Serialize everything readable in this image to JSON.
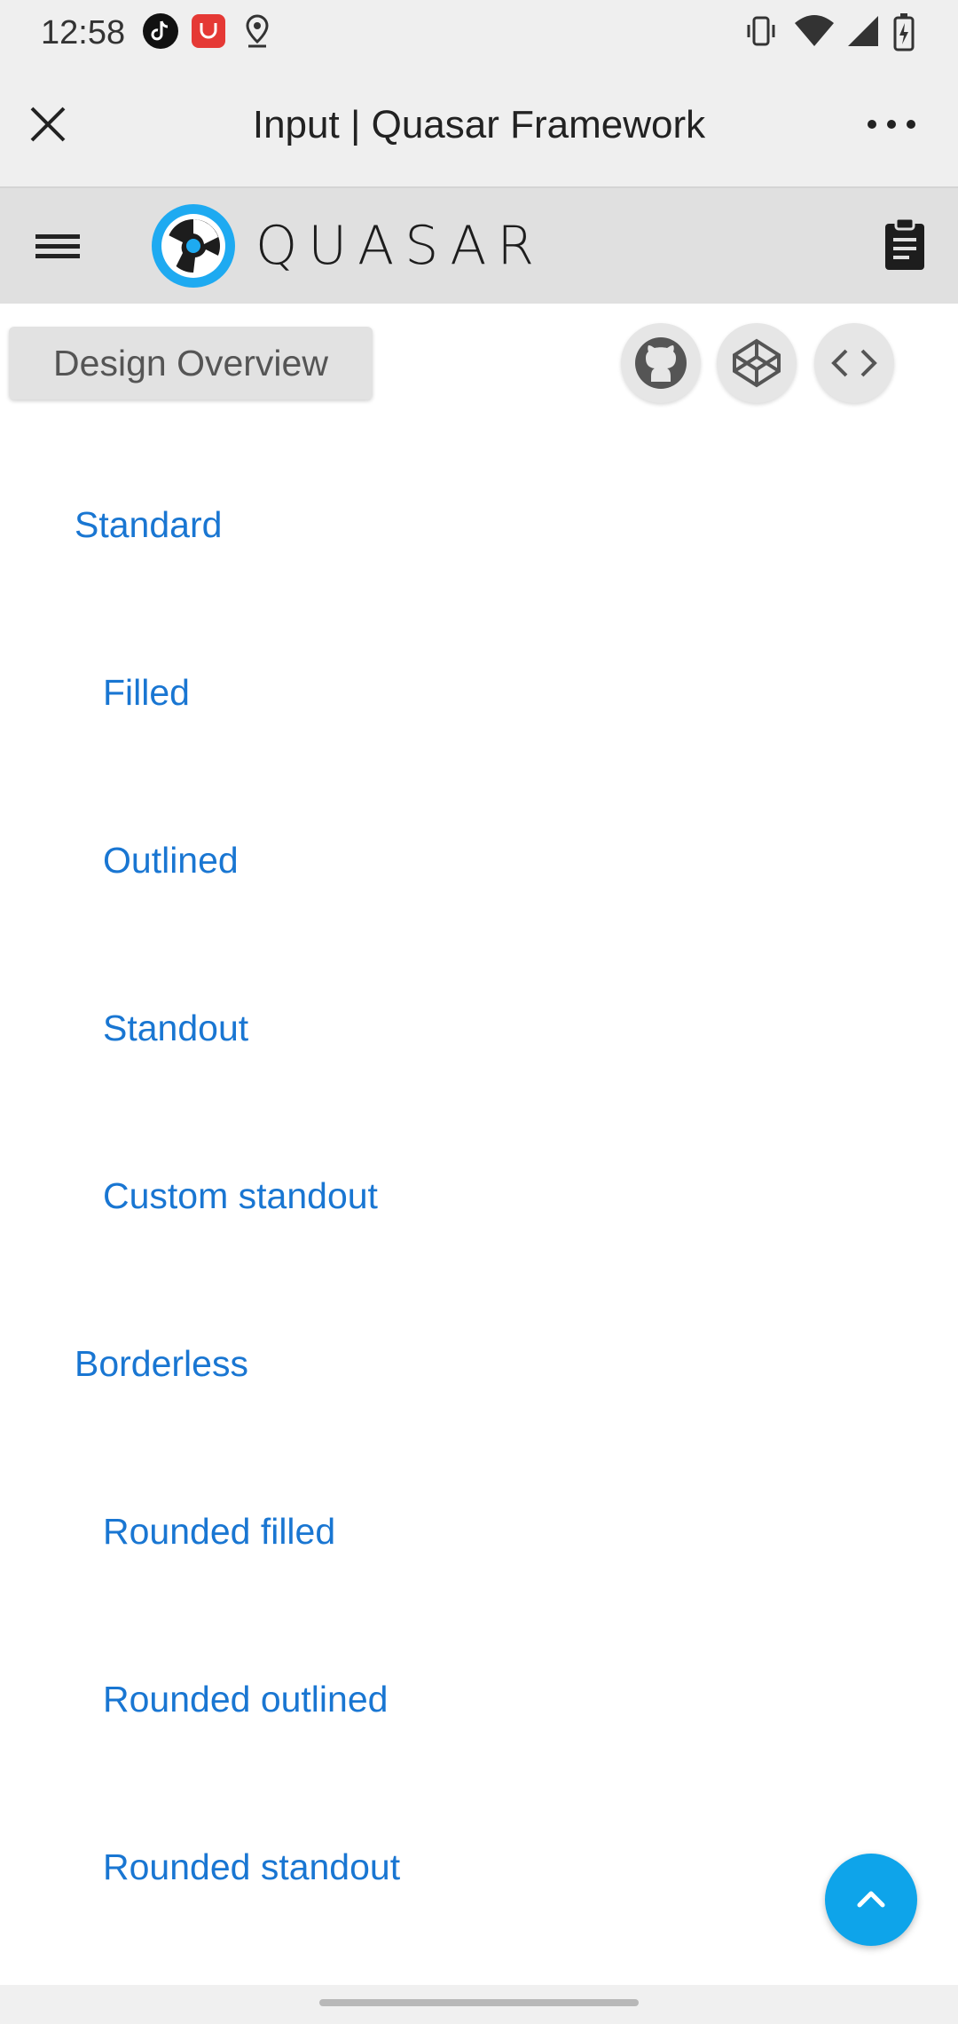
{
  "status_bar": {
    "time": "12:58",
    "left_icons": [
      "tiktok-icon",
      "notification-app-icon",
      "location-icon"
    ],
    "right_icons": [
      "vibrate-icon",
      "wifi-icon",
      "signal-icon",
      "battery-icon"
    ]
  },
  "browser": {
    "title": "Input | Quasar Framework",
    "close_icon": "close-icon",
    "more_icon": "more-icon"
  },
  "toolbar": {
    "brand": "QUASAR",
    "menu_icon": "hamburger-menu-icon",
    "logo_icon": "quasar-logo-icon",
    "clipboard_icon": "clipboard-icon"
  },
  "overview": {
    "label": "Design Overview",
    "actions": [
      "github-icon",
      "codepen-icon",
      "code-icon"
    ]
  },
  "toc": {
    "items": [
      {
        "label": "Standard",
        "level": 1
      },
      {
        "label": "Filled",
        "level": 2
      },
      {
        "label": "Outlined",
        "level": 2
      },
      {
        "label": "Standout",
        "level": 2
      },
      {
        "label": "Custom standout",
        "level": 2
      },
      {
        "label": "Borderless",
        "level": 1
      },
      {
        "label": "Rounded filled",
        "level": 2
      },
      {
        "label": "Rounded outlined",
        "level": 2
      },
      {
        "label": "Rounded standout",
        "level": 2
      }
    ]
  },
  "colors": {
    "link": "#1976d2",
    "fab": "#0ea4ea",
    "toolbar_bg": "#e0e0e0"
  },
  "fab": {
    "icon": "chevron-up-icon"
  }
}
